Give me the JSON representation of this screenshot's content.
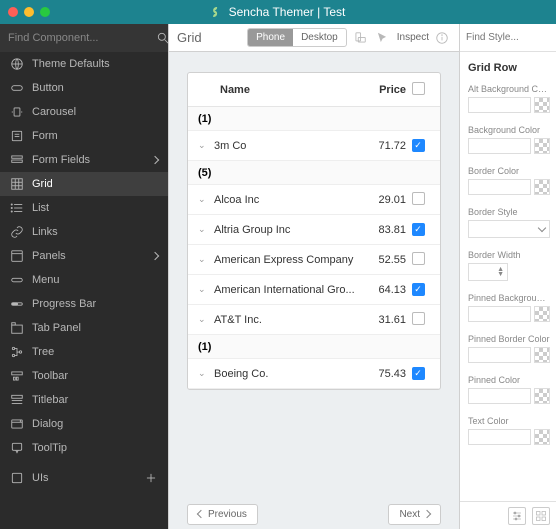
{
  "title": "Sencha Themer | Test",
  "sidebar": {
    "search_placeholder": "Find Component...",
    "items": [
      {
        "label": "Theme Defaults",
        "icon": "globe-icon"
      },
      {
        "label": "Button",
        "icon": "button-icon"
      },
      {
        "label": "Carousel",
        "icon": "carousel-icon"
      },
      {
        "label": "Form",
        "icon": "form-icon"
      },
      {
        "label": "Form Fields",
        "icon": "form-fields-icon",
        "expand": true
      },
      {
        "label": "Grid",
        "icon": "grid-icon",
        "active": true
      },
      {
        "label": "List",
        "icon": "list-icon"
      },
      {
        "label": "Links",
        "icon": "link-icon"
      },
      {
        "label": "Panels",
        "icon": "panels-icon",
        "expand": true
      },
      {
        "label": "Menu",
        "icon": "menu-pill-icon"
      },
      {
        "label": "Progress Bar",
        "icon": "progress-icon"
      },
      {
        "label": "Tab Panel",
        "icon": "tab-panel-icon"
      },
      {
        "label": "Tree",
        "icon": "tree-icon"
      },
      {
        "label": "Toolbar",
        "icon": "toolbar-icon"
      },
      {
        "label": "Titlebar",
        "icon": "titlebar-icon"
      },
      {
        "label": "Dialog",
        "icon": "dialog-icon"
      },
      {
        "label": "ToolTip",
        "icon": "tooltip-icon"
      }
    ],
    "add_label": "UIs"
  },
  "toolbar": {
    "title": "Grid",
    "device": {
      "phone": "Phone",
      "desktop": "Desktop",
      "active": "phone"
    },
    "inspect_label": "Inspect"
  },
  "grid": {
    "columns": {
      "name": "Name",
      "price": "Price"
    },
    "groups": [
      {
        "label": "(1)",
        "rows": [
          {
            "name": "3m Co",
            "price": "71.72",
            "checked": true
          }
        ]
      },
      {
        "label": "(5)",
        "rows": [
          {
            "name": "Alcoa Inc",
            "price": "29.01",
            "checked": false
          },
          {
            "name": "Altria Group Inc",
            "price": "83.81",
            "checked": true
          },
          {
            "name": "American Express Company",
            "price": "52.55",
            "checked": false
          },
          {
            "name": "American International Gro...",
            "price": "64.13",
            "checked": true
          },
          {
            "name": "AT&T Inc.",
            "price": "31.61",
            "checked": false
          }
        ]
      },
      {
        "label": "(1)",
        "rows": [
          {
            "name": "Boeing Co.",
            "price": "75.43",
            "checked": true
          }
        ]
      }
    ]
  },
  "pager": {
    "prev": "Previous",
    "next": "Next"
  },
  "props": {
    "search_placeholder": "Find Style...",
    "section": "Grid Row",
    "fields": {
      "alt_bg": "Alt Background Color",
      "bg": "Background Color",
      "border_color": "Border Color",
      "border_style": "Border Style",
      "border_width": "Border Width",
      "pinned_bg": "Pinned Background Color",
      "pinned_border": "Pinned Border Color",
      "pinned_color": "Pinned Color",
      "text_color": "Text Color"
    }
  }
}
